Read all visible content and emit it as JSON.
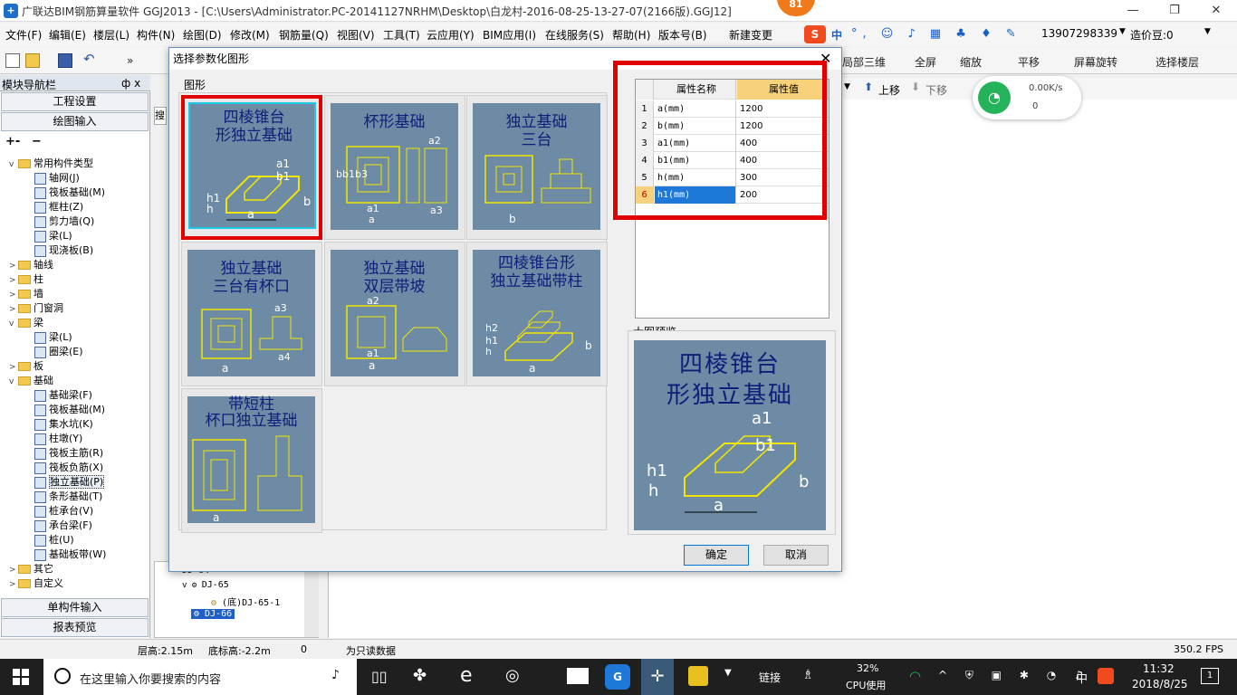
{
  "window": {
    "title": "广联达BIM钢筋算量软件 GGJ2013 - [C:\\Users\\Administrator.PC-20141127NRHM\\Desktop\\白龙村-2016-08-25-13-27-07(2166版).GGJ12]",
    "badge": "81"
  },
  "menubar": [
    "文件(F)",
    "编辑(E)",
    "楼层(L)",
    "构件(N)",
    "绘图(D)",
    "修改(M)",
    "钢筋量(Q)",
    "视图(V)",
    "工具(T)",
    "云应用(Y)",
    "BIM应用(I)",
    "在线服务(S)",
    "帮助(H)",
    "版本号(B)",
    "新建变更"
  ],
  "ime": {
    "s": "S",
    "zh": "中"
  },
  "account": {
    "phone": "13907298339",
    "coins": "造价豆:0"
  },
  "toolbar": {
    "partial3d": "局部三维",
    "fullscreen": "全屏",
    "zoom": "缩放",
    "pan": "平移",
    "rotate": "屏幕旋转",
    "select_floor": "选择楼层"
  },
  "toolbar2": {
    "move_up": "上移",
    "move_down": "下移"
  },
  "net": {
    "speed": "0.00K/s",
    "count": "0"
  },
  "leftpanel": {
    "header": "模块导航栏",
    "pin": "ф x",
    "btn_settings": "工程设置",
    "btn_draw": "绘图输入",
    "btn_single": "单构件输入",
    "btn_report": "报表预览",
    "tree": [
      {
        "label": "常用构件类型",
        "level": 0,
        "expand": "v",
        "type": "folder"
      },
      {
        "label": "轴网(J)",
        "level": 1,
        "type": "item"
      },
      {
        "label": "筏板基础(M)",
        "level": 1,
        "type": "item"
      },
      {
        "label": "框柱(Z)",
        "level": 1,
        "type": "item"
      },
      {
        "label": "剪力墙(Q)",
        "level": 1,
        "type": "item"
      },
      {
        "label": "梁(L)",
        "level": 1,
        "type": "item"
      },
      {
        "label": "现浇板(B)",
        "level": 1,
        "type": "item"
      },
      {
        "label": "轴线",
        "level": 0,
        "expand": ">",
        "type": "folder"
      },
      {
        "label": "柱",
        "level": 0,
        "expand": ">",
        "type": "folder"
      },
      {
        "label": "墙",
        "level": 0,
        "expand": ">",
        "type": "folder"
      },
      {
        "label": "门窗洞",
        "level": 0,
        "expand": ">",
        "type": "folder"
      },
      {
        "label": "梁",
        "level": 0,
        "expand": "v",
        "type": "folder"
      },
      {
        "label": "梁(L)",
        "level": 1,
        "type": "item"
      },
      {
        "label": "圈梁(E)",
        "level": 1,
        "type": "item"
      },
      {
        "label": "板",
        "level": 0,
        "expand": ">",
        "type": "folder"
      },
      {
        "label": "基础",
        "level": 0,
        "expand": "v",
        "type": "folder"
      },
      {
        "label": "基础梁(F)",
        "level": 1,
        "type": "item"
      },
      {
        "label": "筏板基础(M)",
        "level": 1,
        "type": "item"
      },
      {
        "label": "集水坑(K)",
        "level": 1,
        "type": "item"
      },
      {
        "label": "柱墩(Y)",
        "level": 1,
        "type": "item"
      },
      {
        "label": "筏板主筋(R)",
        "level": 1,
        "type": "item"
      },
      {
        "label": "筏板负筋(X)",
        "level": 1,
        "type": "item"
      },
      {
        "label": "独立基础(P)",
        "level": 1,
        "type": "item",
        "selected": true
      },
      {
        "label": "条形基础(T)",
        "level": 1,
        "type": "item"
      },
      {
        "label": "桩承台(V)",
        "level": 1,
        "type": "item"
      },
      {
        "label": "承台梁(F)",
        "level": 1,
        "type": "item"
      },
      {
        "label": "桩(U)",
        "level": 1,
        "type": "item"
      },
      {
        "label": "基础板带(W)",
        "level": 1,
        "type": "item"
      },
      {
        "label": "其它",
        "level": 0,
        "expand": ">",
        "type": "folder"
      },
      {
        "label": "自定义",
        "level": 0,
        "expand": ">",
        "type": "folder"
      }
    ]
  },
  "midtree": {
    "search": "搜",
    "rows": [
      "DJ-64",
      "DJ-65",
      "(底)DJ-65-1",
      "DJ-66"
    ]
  },
  "dialog": {
    "title": "选择参数化图形",
    "group_label": "图形",
    "tiles": [
      {
        "line1": "四棱锥台",
        "line2": "形独立基础"
      },
      {
        "line1": "杯形基础",
        "line2": ""
      },
      {
        "line1": "独立基础",
        "line2": "三台"
      },
      {
        "line1": "独立基础",
        "line2": "三台有杯口"
      },
      {
        "line1": "独立基础",
        "line2": "双层带坡"
      },
      {
        "line1": "四棱锥台形",
        "line2": "独立基础带柱"
      },
      {
        "line1": "带短柱",
        "line2": "杯口独立基础"
      }
    ],
    "prop_header_name": "属性名称",
    "prop_header_value": "属性值",
    "props": [
      {
        "n": "1",
        "name": "a(mm)",
        "value": "1200"
      },
      {
        "n": "2",
        "name": "b(mm)",
        "value": "1200"
      },
      {
        "n": "3",
        "name": "a1(mm)",
        "value": "400"
      },
      {
        "n": "4",
        "name": "b1(mm)",
        "value": "400"
      },
      {
        "n": "5",
        "name": "h(mm)",
        "value": "300"
      },
      {
        "n": "6",
        "name": "h1(mm)",
        "value": "200"
      }
    ],
    "preview_label": "大图预览",
    "preview_title1": "四棱锥台",
    "preview_title2": "形独立基础",
    "ok": "确定",
    "cancel": "取消"
  },
  "statusbar": {
    "floor_height": "层高:2.15m",
    "bottom_elev": "底标高:-2.2m",
    "zero": "0",
    "readonly": "为只读数据",
    "fps": "350.2 FPS"
  },
  "taskbar": {
    "search": "在这里输入你要搜索的内容",
    "link": "链接",
    "cpu_pct": "32%",
    "cpu_label": "CPU使用",
    "ime": "中",
    "time": "11:32",
    "date": "2018/8/25",
    "notif": "1"
  },
  "colors": {
    "accent_red": "#e00000",
    "tile_bg": "#6e8ba6",
    "tile_text": "#0b1f7a",
    "diagram_yellow": "#f2e600"
  }
}
